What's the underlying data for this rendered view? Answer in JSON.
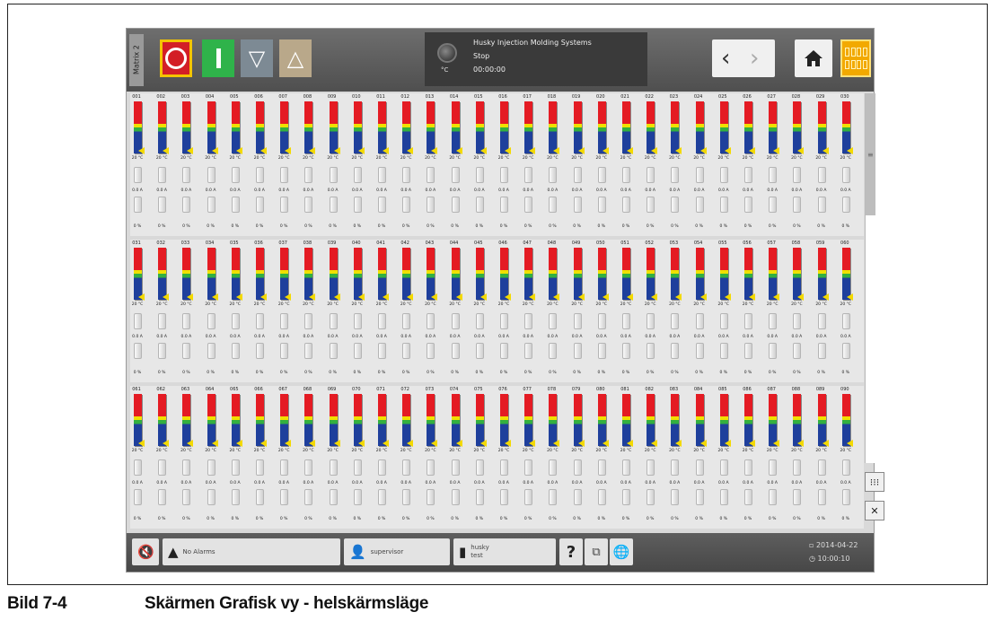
{
  "caption": {
    "number": "Bild 7-4",
    "title": "Skärmen Grafisk vy - helskärmsläge"
  },
  "topbar": {
    "matrix_tab": "Matrix 2",
    "status": {
      "company": "Husky Injection Molding Systems",
      "state": "Stop",
      "time": "00:00:00",
      "unit": "°C"
    },
    "nav_prev": "‹",
    "nav_next": "›"
  },
  "zones": {
    "temp": "20 °C",
    "current": "0.0 A",
    "power": "0 %",
    "rows": [
      [
        "001",
        "002",
        "003",
        "004",
        "005",
        "006",
        "007",
        "008",
        "009",
        "010",
        "011",
        "012",
        "013",
        "014",
        "015",
        "016",
        "017",
        "018",
        "019",
        "020",
        "021",
        "022",
        "023",
        "024",
        "025",
        "026",
        "027",
        "028",
        "029",
        "030"
      ],
      [
        "031",
        "032",
        "033",
        "034",
        "035",
        "036",
        "037",
        "038",
        "039",
        "040",
        "041",
        "042",
        "043",
        "044",
        "045",
        "046",
        "047",
        "048",
        "049",
        "050",
        "051",
        "052",
        "053",
        "054",
        "055",
        "056",
        "057",
        "058",
        "059",
        "060"
      ],
      [
        "061",
        "062",
        "063",
        "064",
        "065",
        "066",
        "067",
        "068",
        "069",
        "070",
        "071",
        "072",
        "073",
        "074",
        "075",
        "076",
        "077",
        "078",
        "079",
        "080",
        "081",
        "082",
        "083",
        "084",
        "085",
        "086",
        "087",
        "088",
        "089",
        "090"
      ]
    ]
  },
  "bottombar": {
    "alarms": "No Alarms",
    "user": "supervisor",
    "mold_name": "husky",
    "mold_sub": "test",
    "help": "?",
    "date": "2014-04-22",
    "time": "10:00:10"
  },
  "colors": {
    "stop": "#d31e26",
    "start": "#2fb34a",
    "grid_button": "#f2a900"
  }
}
